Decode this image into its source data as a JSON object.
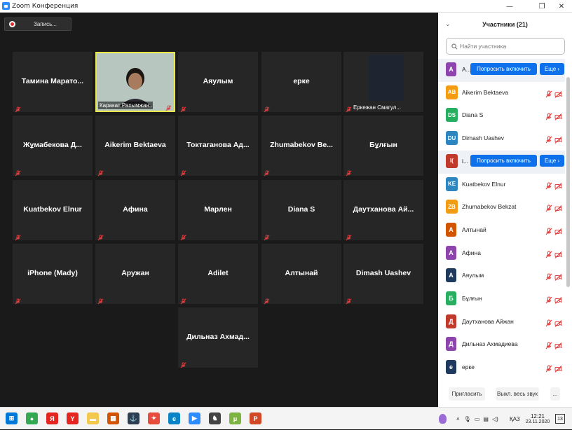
{
  "window": {
    "title": "Zoom Конференция",
    "minimize": "—",
    "maximize": "❐",
    "close": "✕"
  },
  "recording": {
    "label": "Запись..."
  },
  "tiles": [
    {
      "name": "Тамина  Марато...",
      "type": "name"
    },
    {
      "name": "Каракат Рахымжан...",
      "type": "video"
    },
    {
      "name": "Аяулым",
      "type": "name"
    },
    {
      "name": "ерке",
      "type": "name"
    },
    {
      "name": "Еркежан Смагул...",
      "type": "darkcam"
    },
    {
      "name": "Жұмабекова Д...",
      "type": "name"
    },
    {
      "name": "Aikerim Bektaeva",
      "type": "name"
    },
    {
      "name": "Токтаганова  Ад...",
      "type": "name"
    },
    {
      "name": "Zhumabekov  Be...",
      "type": "name"
    },
    {
      "name": "Бұлғын",
      "type": "name"
    },
    {
      "name": "Kuatbekov Elnur",
      "type": "name"
    },
    {
      "name": "Афина",
      "type": "name"
    },
    {
      "name": "Марлен",
      "type": "name"
    },
    {
      "name": "Diana S",
      "type": "name"
    },
    {
      "name": "Даутханова  Ай...",
      "type": "name"
    },
    {
      "name": "iPhone (Mady)",
      "type": "name"
    },
    {
      "name": "Аружан",
      "type": "name"
    },
    {
      "name": "Adilet",
      "type": "name"
    },
    {
      "name": "Алтынай",
      "type": "name"
    },
    {
      "name": "Dimash Uashev",
      "type": "name"
    },
    {
      "name": "Дильназ  Ахмад...",
      "type": "name"
    }
  ],
  "panel": {
    "title": "Участники (21)",
    "search_placeholder": "Найти участника",
    "ask_label": "Попросить включить",
    "more_label": "Еще ›",
    "participants": [
      {
        "initials": "А",
        "name": "А...",
        "color": "#8e44ad",
        "request": true
      },
      {
        "initials": "AB",
        "name": "Aikerim Bektaeva",
        "color": "#f39c12"
      },
      {
        "initials": "DS",
        "name": "Diana S",
        "color": "#27ae60"
      },
      {
        "initials": "DU",
        "name": "Dimash Uashev",
        "color": "#2e86c1"
      },
      {
        "initials": "I(",
        "name": "i...",
        "color": "#c0392b",
        "request": true
      },
      {
        "initials": "KE",
        "name": "Kuatbekov Elnur",
        "color": "#2e86c1"
      },
      {
        "initials": "ZB",
        "name": "Zhumabekov Bekzat",
        "color": "#f39c12"
      },
      {
        "initials": "А",
        "name": "Алтынай",
        "color": "#d35400"
      },
      {
        "initials": "А",
        "name": "Афина",
        "color": "#8e44ad"
      },
      {
        "initials": "А",
        "name": "Аяулым",
        "color": "#1f3a5f"
      },
      {
        "initials": "Б",
        "name": "Бұлғын",
        "color": "#27ae60"
      },
      {
        "initials": "Д",
        "name": "Даутханова Айжан",
        "color": "#c0392b"
      },
      {
        "initials": "Д",
        "name": "Дильназ Ахмадиева",
        "color": "#8e44ad"
      },
      {
        "initials": "е",
        "name": "ерке",
        "color": "#1f3a5f"
      }
    ],
    "footer": {
      "invite": "Пригласить",
      "mute_all": "Выкл. весь звук",
      "more": "..."
    }
  },
  "taskbar": {
    "icons": [
      {
        "name": "windows-start-icon",
        "glyph": "⊞",
        "color": "#0078d7"
      },
      {
        "name": "chrome-icon",
        "glyph": "●",
        "color": "#34a853"
      },
      {
        "name": "yandex-icon",
        "glyph": "Я",
        "color": "#e52620"
      },
      {
        "name": "yandex-browser-icon",
        "glyph": "Y",
        "color": "#e52620"
      },
      {
        "name": "file-explorer-icon",
        "glyph": "▬",
        "color": "#f2c94c"
      },
      {
        "name": "store-icon",
        "glyph": "▦",
        "color": "#d35400"
      },
      {
        "name": "anchor-app-icon",
        "glyph": "⚓",
        "color": "#2c3e50"
      },
      {
        "name": "paint-app-icon",
        "glyph": "✦",
        "color": "#e74c3c"
      },
      {
        "name": "edge-icon",
        "glyph": "e",
        "color": "#0a84c7"
      },
      {
        "name": "zoom-icon",
        "glyph": "▶",
        "color": "#2d8cff"
      },
      {
        "name": "game-app-icon",
        "glyph": "♞",
        "color": "#444444"
      },
      {
        "name": "torrent-icon",
        "glyph": "μ",
        "color": "#7cb342"
      },
      {
        "name": "presentation-icon",
        "glyph": "P",
        "color": "#d24726"
      }
    ],
    "lang": "ҚАЗ",
    "time": "12:21",
    "date": "23.11.2020",
    "notifications": "13"
  }
}
